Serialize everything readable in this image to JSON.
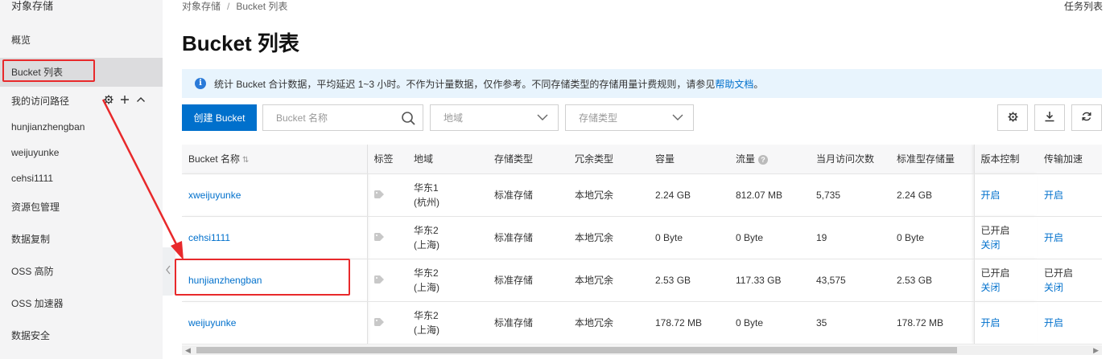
{
  "sidebar": {
    "title": "对象存储",
    "items": [
      {
        "label": "概览"
      },
      {
        "label": "Bucket 列表"
      },
      {
        "label": "我的访问路径"
      },
      {
        "label": "hunjianzhengban"
      },
      {
        "label": "weijuyunke"
      },
      {
        "label": "cehsi1111"
      },
      {
        "label": "资源包管理"
      },
      {
        "label": "数据复制"
      },
      {
        "label": "OSS 高防"
      },
      {
        "label": "OSS 加速器"
      },
      {
        "label": "数据安全"
      }
    ]
  },
  "breadcrumb": {
    "root": "对象存储",
    "sep": "/",
    "current": "Bucket 列表"
  },
  "header": {
    "task_list": "任务列表",
    "title": "Bucket 列表"
  },
  "notice": {
    "text": "统计 Bucket 合计数据，平均延迟 1~3 小时。不作为计量数据，仅作参考。不同存储类型的存储用量计费规则，请参见",
    "link": "帮助文档",
    "end": "。"
  },
  "toolbar": {
    "create_label": "创建 Bucket",
    "search_placeholder": "Bucket 名称",
    "region_placeholder": "地域",
    "type_placeholder": "存储类型"
  },
  "table": {
    "headers": [
      "Bucket 名称",
      "标签",
      "地域",
      "存储类型",
      "冗余类型",
      "容量",
      "流量",
      "当月访问次数",
      "标准型存储量",
      "版本控制",
      "传输加速"
    ],
    "rows": [
      {
        "name": "xweijuyunke",
        "region1": "华东1",
        "region2": "(杭州)",
        "storage": "标准存储",
        "redundancy": "本地冗余",
        "capacity": "2.24 GB",
        "traffic": "812.07 MB",
        "visits": "5,735",
        "std": "2.24 GB",
        "ver_status": "",
        "ver_link": "开启",
        "acc_status": "",
        "acc_link": "开启"
      },
      {
        "name": "cehsi1111",
        "region1": "华东2",
        "region2": "(上海)",
        "storage": "标准存储",
        "redundancy": "本地冗余",
        "capacity": "0 Byte",
        "traffic": "0 Byte",
        "visits": "19",
        "std": "0 Byte",
        "ver_status": "已开启",
        "ver_link": "关闭",
        "acc_status": "",
        "acc_link": "开启"
      },
      {
        "name": "hunjianzhengban",
        "region1": "华东2",
        "region2": "(上海)",
        "storage": "标准存储",
        "redundancy": "本地冗余",
        "capacity": "2.53 GB",
        "traffic": "117.33 GB",
        "visits": "43,575",
        "std": "2.53 GB",
        "ver_status": "已开启",
        "ver_link": "关闭",
        "acc_status": "已开启",
        "acc_link": "关闭"
      },
      {
        "name": "weijuyunke",
        "region1": "华东2",
        "region2": "(上海)",
        "storage": "标准存储",
        "redundancy": "本地冗余",
        "capacity": "178.72 MB",
        "traffic": "0 Byte",
        "visits": "35",
        "std": "178.72 MB",
        "ver_status": "",
        "ver_link": "开启",
        "acc_status": "",
        "acc_link": "开启"
      }
    ]
  },
  "colors": {
    "primary": "#0070cc",
    "annotation": "#e8292b",
    "notice_bg": "#e8f4fd"
  },
  "icons": [
    "settings-icon",
    "plus-icon",
    "chevron-up-icon",
    "info-icon",
    "search-icon",
    "chevron-down-icon",
    "gear-icon",
    "download-icon",
    "refresh-icon",
    "tag-icon",
    "help-icon",
    "sort-icon",
    "chevron-left-icon"
  ]
}
